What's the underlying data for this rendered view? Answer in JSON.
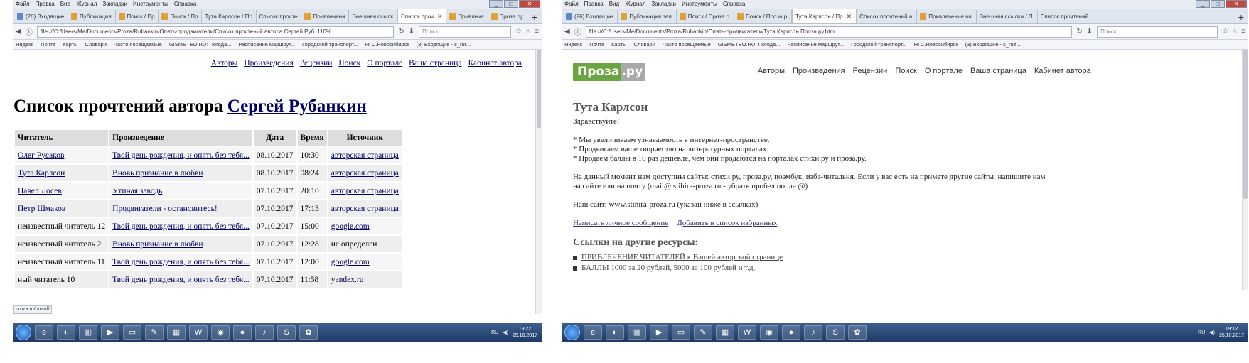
{
  "left": {
    "menu": [
      "Файл",
      "Правка",
      "Вид",
      "Журнал",
      "Закладки",
      "Инструменты",
      "Справка"
    ],
    "tabs": [
      {
        "label": "(26) Входящие",
        "icon": "mail"
      },
      {
        "label": "Публикация",
        "icon": "doc"
      },
      {
        "label": "Поиск / Пр",
        "icon": "doc"
      },
      {
        "label": "Поиск / Пр",
        "icon": "doc"
      },
      {
        "label": "Тута Карлсон / Пр",
        "icon": "none"
      },
      {
        "label": "Список прочте",
        "icon": "none"
      },
      {
        "label": "Привлечени",
        "icon": "doc"
      },
      {
        "label": "Внешняя ссылк",
        "icon": "none"
      },
      {
        "label": "Список проч",
        "icon": "none",
        "active": true
      },
      {
        "label": "Привлече",
        "icon": "doc"
      },
      {
        "label": "Проза.ру",
        "icon": "doc"
      }
    ],
    "url": "file:///C:/Users/Me/Documents/Proza/Rubankin/Опять-продвигатели/Список прочтений автора Сергей Руб",
    "zoom": "110%",
    "search_placeholder": "Поиск",
    "bookmarks": [
      "Яндекс",
      "Почта",
      "Карты",
      "Словари",
      "Часто посещаемые",
      "GISMETEO.RU: Погода...",
      "Расписание маршрут...",
      "Городской транспорт...",
      "НГС.Новосибирск",
      "(3) Входящие - s_rut..."
    ],
    "topnav": [
      "Авторы",
      "Произведения",
      "Рецензии",
      "Поиск",
      "О портале",
      "Ваша страница",
      "Кабинет автора"
    ],
    "title_prefix": "Список прочтений автора",
    "title_author": "Сергей Рубанкин",
    "table_headers": [
      "Читатель",
      "Произведение",
      "Дата",
      "Время",
      "Источник"
    ],
    "rows": [
      {
        "reader": "Олег Русаков",
        "reader_link": true,
        "work": "Твой день рождения, и опять без тебя...",
        "date": "08.10.2017",
        "time": "10:30",
        "source": "авторская страница",
        "source_link": true
      },
      {
        "reader": "Тута Карлсон",
        "reader_link": true,
        "work": "Вновь признание в любви",
        "date": "08.10.2017",
        "time": "08:24",
        "source": "авторская страница",
        "source_link": true
      },
      {
        "reader": "Павел Лосев",
        "reader_link": true,
        "work": "Утиная заводь",
        "date": "07.10.2017",
        "time": "20:10",
        "source": "авторская страница",
        "source_link": true
      },
      {
        "reader": "Петр Шмаков",
        "reader_link": true,
        "work": "Продвигатели - остановитесь!",
        "date": "07.10.2017",
        "time": "17:13",
        "source": "авторская страница",
        "source_link": true
      },
      {
        "reader": "неизвестный читатель 12",
        "reader_link": false,
        "work": "Твой день рождения, и опять без тебя...",
        "date": "07.10.2017",
        "time": "15:00",
        "source": "google.com",
        "source_link": true
      },
      {
        "reader": "неизвестный читатель 2",
        "reader_link": false,
        "work": "Вновь признание в любви",
        "date": "07.10.2017",
        "time": "12:28",
        "source": "не определен",
        "source_link": false
      },
      {
        "reader": "неизвестный читатель 11",
        "reader_link": false,
        "work": "Твой день рождения, и опять без тебя...",
        "date": "07.10.2017",
        "time": "12:00",
        "source": "google.com",
        "source_link": true
      },
      {
        "reader": "ный читатель 10",
        "reader_link": false,
        "work": "Твой день рождения, и опять без тебя...",
        "date": "07.10.2017",
        "time": "11:58",
        "source": "yandex.ru",
        "source_link": true
      }
    ],
    "status_url": "proza.ru/board/",
    "tray": {
      "lang": "RU",
      "time": "19:22",
      "date": "25.10.2017"
    }
  },
  "right": {
    "menu": [
      "Файл",
      "Правка",
      "Вид",
      "Журнал",
      "Закладки",
      "Инструменты",
      "Справка"
    ],
    "tabs": [
      {
        "label": "(26) Входящие",
        "icon": "mail"
      },
      {
        "label": "Публикация зап",
        "icon": "doc"
      },
      {
        "label": "Поиск / Проза.р",
        "icon": "doc"
      },
      {
        "label": "Поиск / Проза.р",
        "icon": "doc"
      },
      {
        "label": "Тута Карлсон / Пр",
        "icon": "none",
        "active": true
      },
      {
        "label": "Список прочтений а",
        "icon": "none"
      },
      {
        "label": "Привлечение чи",
        "icon": "doc"
      },
      {
        "label": "Внешняя ссылка / П",
        "icon": "none"
      },
      {
        "label": "Список прочтений",
        "icon": "none"
      }
    ],
    "url": "file:///C:/Users/Me/Documents/Proza/Rubankin/Опять-продвигатели/Тута Карлсон    Проза.ру.htm",
    "search_placeholder": "Поиск",
    "bookmarks": [
      "Яндекс",
      "Почта",
      "Карты",
      "Словари",
      "Часто посещаемые",
      "GISMETEO.RU: Погода...",
      "Расписание маршрут...",
      "Городской транспорт...",
      "НГС.Новосибирск",
      "(3) Входящие - s_ruz..."
    ],
    "logo_a": "Проза",
    "logo_b": ".ру",
    "topnav": [
      "Авторы",
      "Произведения",
      "Рецензии",
      "Поиск",
      "О портале",
      "Ваша страница",
      "Кабинет автора"
    ],
    "author_name": "Тута Карлсон",
    "greeting": "Здравствуйте!",
    "bullets": [
      "* Мы увеличиваем узнаваемость в интернет-пространстве.",
      "* Продвигаем ваше творчество на литературных порталах.",
      "* Продаем баллы в 10 раз дешевле, чем они продаются на порталах стихи.ру и проза.ру."
    ],
    "para1_line1": "На данный момент нам доступны сайты: стихи.ру, проза.ру, поэмбук, изба-читальня. Если у вас есть на примете другие сайты, напишите нам",
    "para1_line2": "на сайте или на почту (mail@ stihira-proza.ru - убрать пробел после @)",
    "site_line": "Наш сайт: www.stihira-proza.ru (указан ниже в ссылках)",
    "links": [
      "Написать личное сообщение",
      "Добавить в список избранных"
    ],
    "resources_heading": "Ссылки на другие ресурсы:",
    "resources": [
      "ПРИВЛЕЧЕНИЕ ЧИТАТЕЛЕЙ к Вашей авторской странице",
      "БАЛЛЫ 1000 за 20 рублей, 5000 за 100 рублей и т.д."
    ],
    "tray": {
      "lang": "RU",
      "time": "19:12",
      "date": "25.10.2017"
    }
  }
}
